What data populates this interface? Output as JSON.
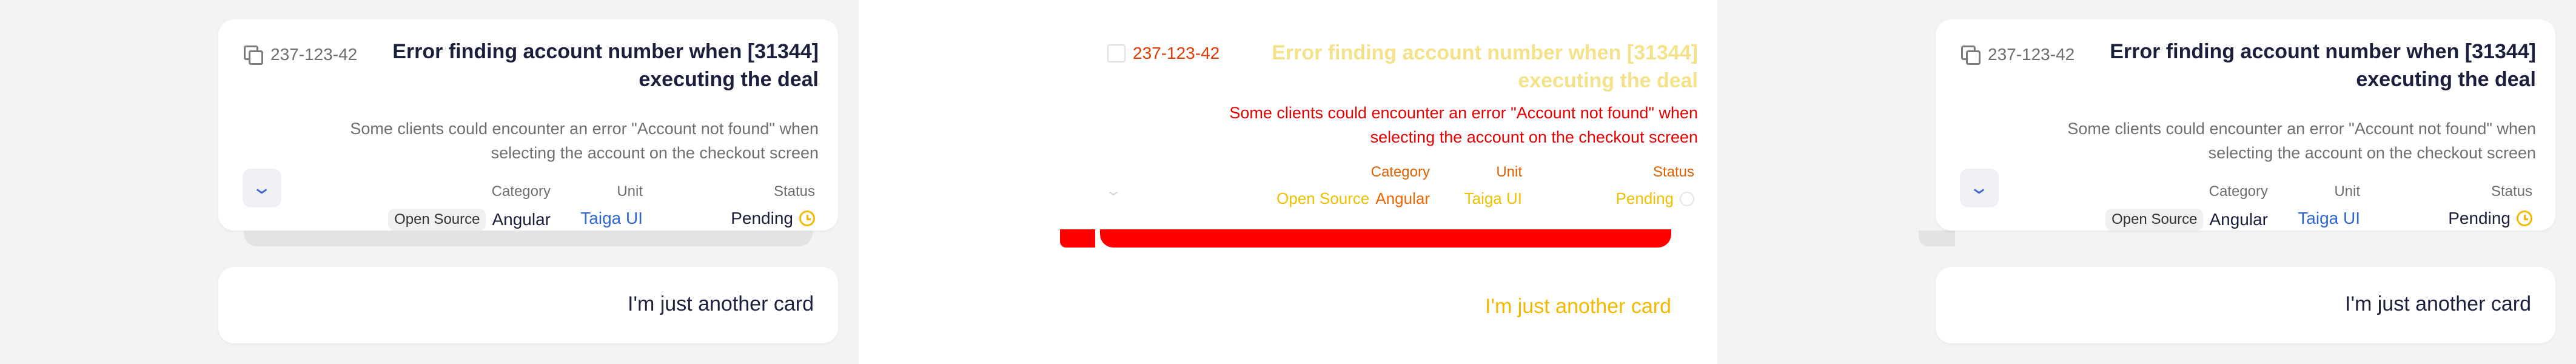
{
  "card": {
    "ticket_id": "237-123-42",
    "title": "Error finding account number when [31344] executing the deal",
    "description": "Some clients could encounter an error \"Account not found\" when selecting the account on the checkout screen",
    "category_label": "Category",
    "category_badge": "Open Source",
    "category_value": "Angular",
    "unit_label": "Unit",
    "unit_value": "Taiga UI",
    "status_label": "Status",
    "status_value": "Pending",
    "expand_icon": "chevron-down-icon",
    "copy_icon": "copy-icon",
    "status_icon": "clock-icon"
  },
  "other_card": {
    "text": "I'm just another card"
  },
  "colors": {
    "accent": "#2f66d6",
    "pending": "#f5b800",
    "title": "#1b1f3b",
    "debug_red": "#ff0000"
  }
}
